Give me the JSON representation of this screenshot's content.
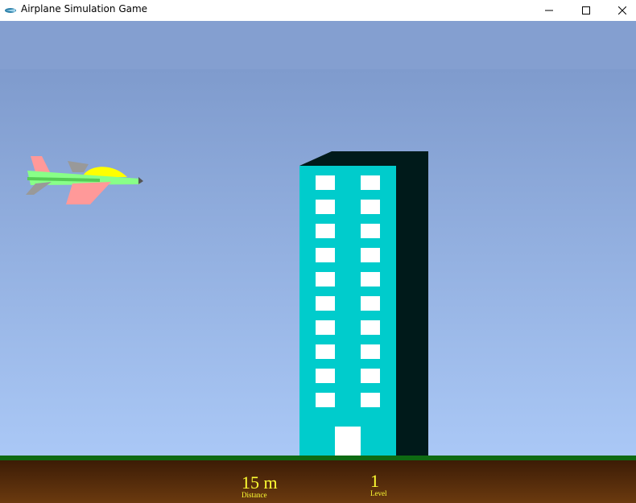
{
  "window": {
    "title": "Airplane Simulation Game",
    "icon": "airplane-app-icon",
    "controls": {
      "minimize": "minimize-icon",
      "maximize": "maximize-icon",
      "close": "close-icon"
    }
  },
  "game": {
    "colors": {
      "sky_top": "#849fd0",
      "sky_bottom": "#aac8f6",
      "grass": "#0e6a12",
      "ground": "#4a250a",
      "building_front": "#00cccc",
      "building_side": "#001a1a",
      "window": "#ffffff",
      "hud_text": "#ffff33",
      "plane_body": "#88ff88",
      "plane_wing": "#ff9999",
      "plane_canopy": "#ffff00"
    },
    "building": {
      "window_rows": 10,
      "window_columns": 2
    },
    "hud": {
      "distance_value": "15 m",
      "distance_label": "Distance",
      "level_value": "1",
      "level_label": "Level"
    }
  }
}
